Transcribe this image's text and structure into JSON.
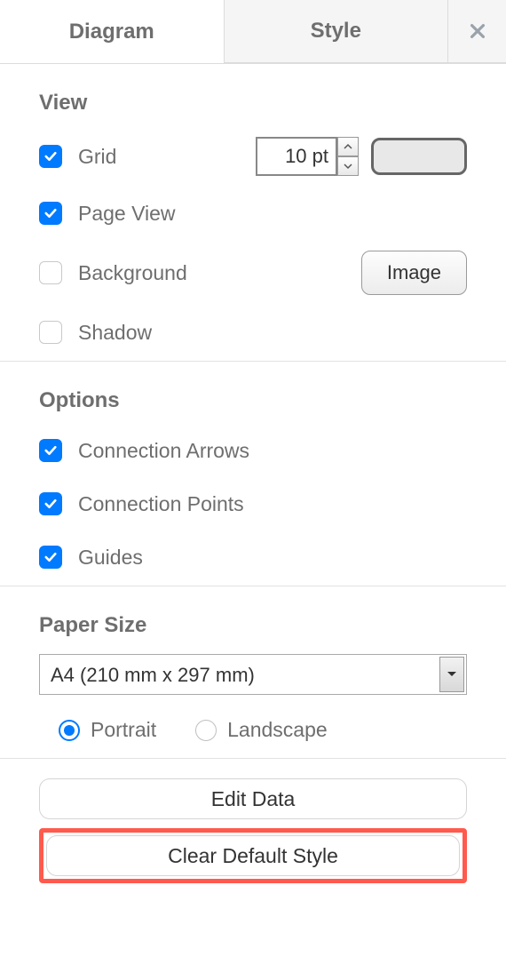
{
  "tabs": {
    "diagram": "Diagram",
    "style": "Style"
  },
  "view": {
    "title": "View",
    "grid_label": "Grid",
    "grid_value": "10 pt",
    "page_view_label": "Page View",
    "background_label": "Background",
    "image_button": "Image",
    "shadow_label": "Shadow"
  },
  "options": {
    "title": "Options",
    "connection_arrows": "Connection Arrows",
    "connection_points": "Connection Points",
    "guides": "Guides"
  },
  "paper": {
    "title": "Paper Size",
    "selected": "A4 (210 mm x 297 mm)",
    "portrait": "Portrait",
    "landscape": "Landscape"
  },
  "actions": {
    "edit_data": "Edit Data",
    "clear_default_style": "Clear Default Style"
  }
}
